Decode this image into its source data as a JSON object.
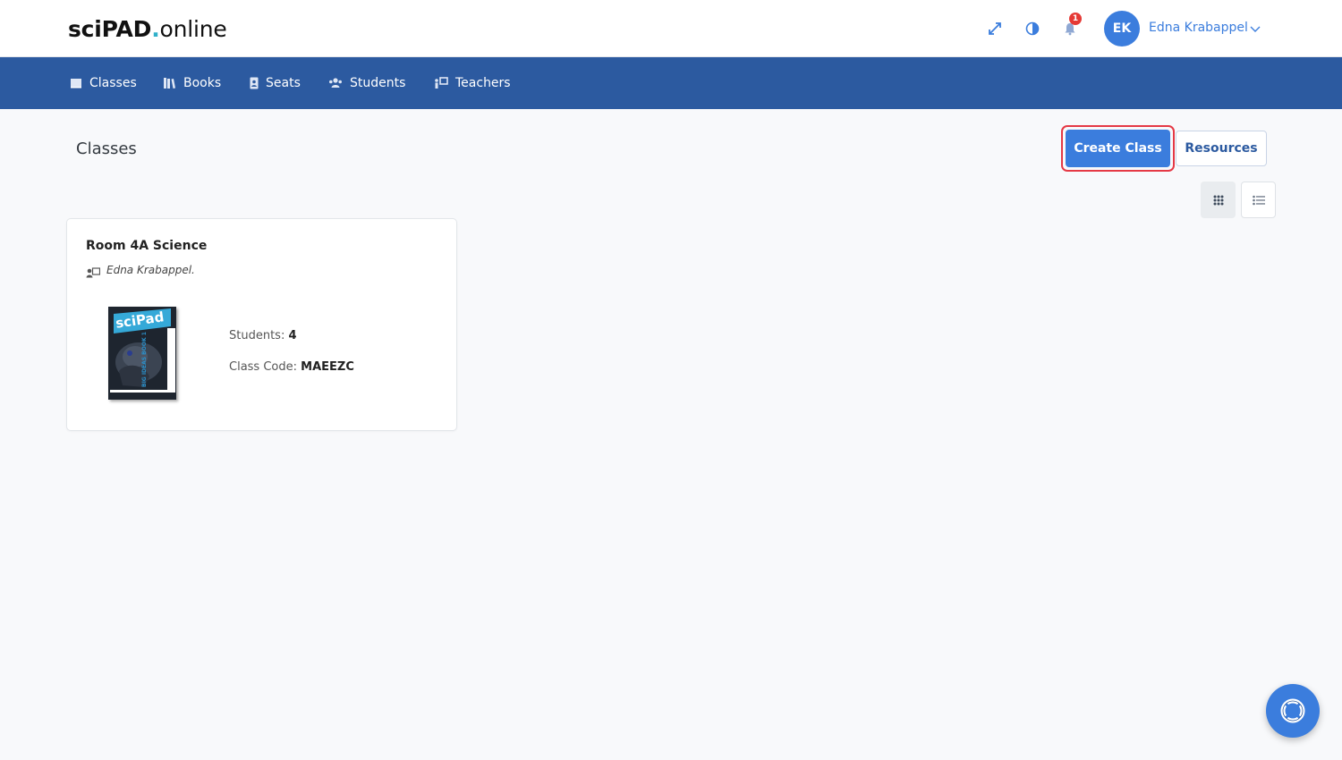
{
  "brand": {
    "part1": "sciPAD",
    "dot": ".",
    "part2": "online"
  },
  "header": {
    "icons": [
      "expand-icon",
      "contrast-icon",
      "bell-icon"
    ],
    "notification_count": "1",
    "user": {
      "initials": "EK",
      "name": "Edna Krabappel"
    }
  },
  "nav": {
    "items": [
      {
        "label": "Classes",
        "icon": "classes-icon"
      },
      {
        "label": "Books",
        "icon": "books-icon"
      },
      {
        "label": "Seats",
        "icon": "seats-icon"
      },
      {
        "label": "Students",
        "icon": "students-icon"
      },
      {
        "label": "Teachers",
        "icon": "teachers-icon"
      }
    ]
  },
  "page": {
    "title": "Classes",
    "create_label": "Create Class",
    "resources_label": "Resources"
  },
  "classes": [
    {
      "name": "Room 4A Science",
      "teacher": "Edna Krabappel.",
      "students_label": "Students:",
      "students_value": "4",
      "code_label": "Class Code:",
      "code_value": "MAEEZC",
      "cover": {
        "brand": "sciPad",
        "subtitle": "BIG IDEAS BOOK 1"
      }
    }
  ],
  "colors": {
    "primary": "#3b7ddd",
    "navbar": "#2c5aa0",
    "alert": "#e53935"
  }
}
